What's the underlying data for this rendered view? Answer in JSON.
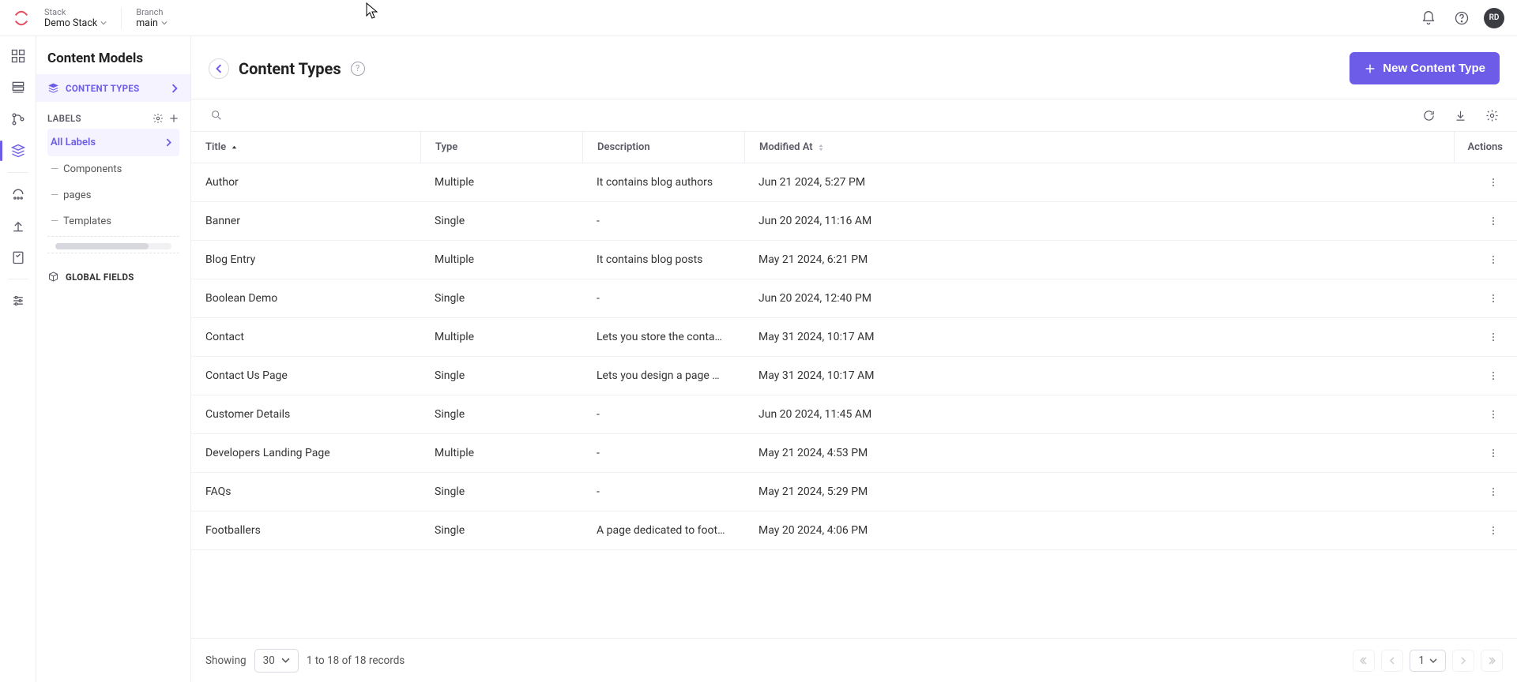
{
  "topbar": {
    "stack_label": "Stack",
    "stack_value": "Demo Stack",
    "branch_label": "Branch",
    "branch_value": "main",
    "avatar": "RD"
  },
  "leftpanel": {
    "title": "Content Models",
    "content_types_label": "CONTENT TYPES",
    "labels_header": "LABELS",
    "all_labels": "All Labels",
    "labels": [
      {
        "name": "Components"
      },
      {
        "name": "pages"
      },
      {
        "name": "Templates"
      }
    ],
    "global_fields_label": "GLOBAL FIELDS"
  },
  "main": {
    "title": "Content Types",
    "new_button": "New Content Type"
  },
  "table": {
    "columns": {
      "title": "Title",
      "type": "Type",
      "description": "Description",
      "modified": "Modified At",
      "actions": "Actions"
    },
    "rows": [
      {
        "title": "Author",
        "type": "Multiple",
        "desc": "It contains blog authors",
        "modified": "Jun 21 2024, 5:27 PM"
      },
      {
        "title": "Banner",
        "type": "Single",
        "desc": "-",
        "modified": "Jun 20 2024, 11:16 AM"
      },
      {
        "title": "Blog Entry",
        "type": "Multiple",
        "desc": "It contains blog posts",
        "modified": "May 21 2024, 6:21 PM"
      },
      {
        "title": "Boolean Demo",
        "type": "Single",
        "desc": "-",
        "modified": "Jun 20 2024, 12:40 PM"
      },
      {
        "title": "Contact",
        "type": "Multiple",
        "desc": "Lets you store the conta…",
        "modified": "May 31 2024, 10:17 AM"
      },
      {
        "title": "Contact Us Page",
        "type": "Single",
        "desc": "Lets you design a page …",
        "modified": "May 31 2024, 10:17 AM"
      },
      {
        "title": "Customer Details",
        "type": "Single",
        "desc": "-",
        "modified": "Jun 20 2024, 11:45 AM"
      },
      {
        "title": "Developers Landing Page",
        "type": "Multiple",
        "desc": "-",
        "modified": "May 21 2024, 4:53 PM"
      },
      {
        "title": "FAQs",
        "type": "Single",
        "desc": "-",
        "modified": "May 21 2024, 5:29 PM"
      },
      {
        "title": "Footballers",
        "type": "Single",
        "desc": "A page dedicated to foot…",
        "modified": "May 20 2024, 4:06 PM"
      }
    ]
  },
  "footer": {
    "showing": "Showing",
    "page_size": "30",
    "range": "1 to 18 of 18 records",
    "current_page": "1"
  }
}
